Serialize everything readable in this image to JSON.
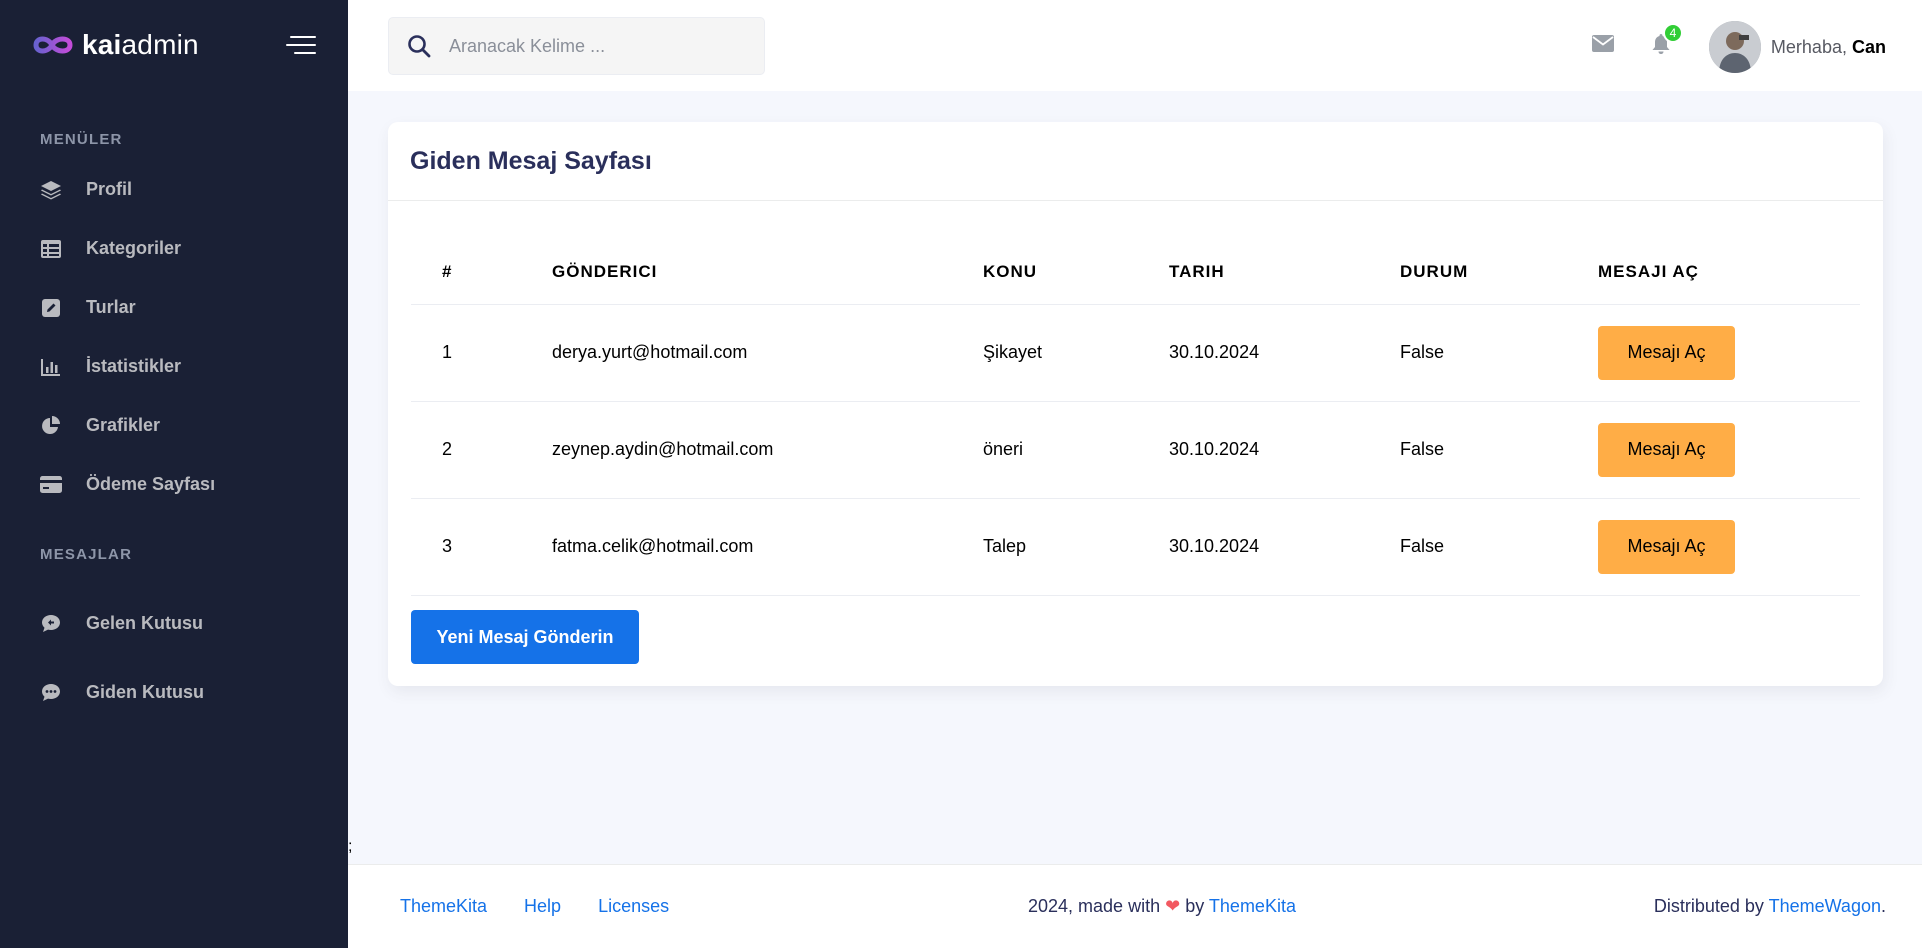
{
  "brand": {
    "prefix": "kai",
    "suffix": "admin"
  },
  "sidebar": {
    "section1": "MENÜLER",
    "items": [
      {
        "label": "Profil",
        "icon": "layers-icon"
      },
      {
        "label": "Kategoriler",
        "icon": "table-icon"
      },
      {
        "label": "Turlar",
        "icon": "pen-square-icon"
      },
      {
        "label": "İstatistikler",
        "icon": "bar-chart-icon"
      },
      {
        "label": "Grafikler",
        "icon": "pie-chart-icon"
      },
      {
        "label": "Ödeme Sayfası",
        "icon": "credit-card-icon"
      }
    ],
    "section2": "MESAJLAR",
    "messages": [
      {
        "label": "Gelen Kutusu",
        "icon": "comment-icon"
      },
      {
        "label": "Giden Kutusu",
        "icon": "comment-dots-icon"
      }
    ]
  },
  "header": {
    "search_placeholder": "Aranacak Kelime ...",
    "notification_count": "4",
    "greeting": "Merhaba,",
    "user_name": "Can"
  },
  "page": {
    "title": "Giden Mesaj Sayfası",
    "columns": [
      "#",
      "GÖNDERICI",
      "KONU",
      "TARIH",
      "DURUM",
      "MESAJI AÇ"
    ],
    "rows": [
      {
        "no": "1",
        "sender": "derya.yurt@hotmail.com",
        "subject": "Şikayet",
        "date": "30.10.2024",
        "status": "False",
        "action": "Mesajı Aç"
      },
      {
        "no": "2",
        "sender": "zeynep.aydin@hotmail.com",
        "subject": "öneri",
        "date": "30.10.2024",
        "status": "False",
        "action": "Mesajı Aç"
      },
      {
        "no": "3",
        "sender": "fatma.celik@hotmail.com",
        "subject": "Talep",
        "date": "30.10.2024",
        "status": "False",
        "action": "Mesajı Aç"
      }
    ],
    "new_button": "Yeni Mesaj Gönderin",
    "stray_text": ";"
  },
  "footer": {
    "links": [
      "ThemeKita",
      "Help",
      "Licenses"
    ],
    "made_prefix": "2024, made with",
    "made_by": "by",
    "made_link": "ThemeKita",
    "distributed_prefix": "Distributed by",
    "distributed_link": "ThemeWagon",
    "distributed_suffix": "."
  },
  "colors": {
    "sidebar_bg": "#1a2035",
    "primary": "#1572e8",
    "warning": "#ffad46",
    "success": "#31ce36",
    "page_bg": "#f5f7fd"
  }
}
